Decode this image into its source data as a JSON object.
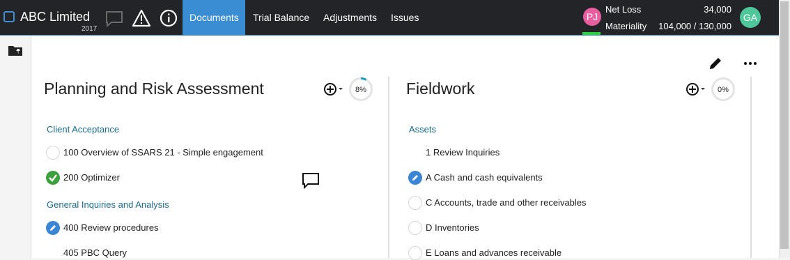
{
  "header": {
    "company": "ABC Limited",
    "year": "2017",
    "tabs": [
      {
        "label": "Documents",
        "active": true
      },
      {
        "label": "Trial Balance",
        "active": false
      },
      {
        "label": "Adjustments",
        "active": false
      },
      {
        "label": "Issues",
        "active": false
      }
    ],
    "user_initials": "PJ",
    "net_loss_label": "Net Loss",
    "net_loss_value": "34,000",
    "materiality_label": "Materiality",
    "materiality_value": "104,000 / 130,000",
    "account_initials": "GA"
  },
  "colors": {
    "topbar": "#232427",
    "active_tab": "#3a8dd3",
    "section_heading": "#1c6a8c",
    "done": "#3ca03c",
    "edit": "#3a86d4"
  },
  "columns": [
    {
      "title": "Planning and Risk Assessment",
      "progress_label": "8%",
      "progress": 0.08,
      "sections": [
        {
          "heading": "Client Acceptance",
          "items": [
            {
              "label": "100 Overview of SSARS 21 - Simple engagement",
              "status": "empty"
            },
            {
              "label": "200 Optimizer",
              "status": "done"
            }
          ]
        },
        {
          "heading": "General Inquiries and Analysis",
          "items": [
            {
              "label": "400 Review procedures",
              "status": "edit"
            },
            {
              "label": "405 PBC Query",
              "status": "none"
            }
          ]
        }
      ]
    },
    {
      "title": "Fieldwork",
      "progress_label": "0%",
      "progress": 0,
      "sections": [
        {
          "heading": "Assets",
          "items": [
            {
              "label": "1 Review Inquiries",
              "status": "none"
            },
            {
              "label": "A Cash and cash equivalents",
              "status": "edit"
            },
            {
              "label": "C Accounts, trade and other receivables",
              "status": "empty"
            },
            {
              "label": "D Inventories",
              "status": "empty"
            },
            {
              "label": "E Loans and advances receivable",
              "status": "empty"
            }
          ]
        }
      ]
    }
  ]
}
